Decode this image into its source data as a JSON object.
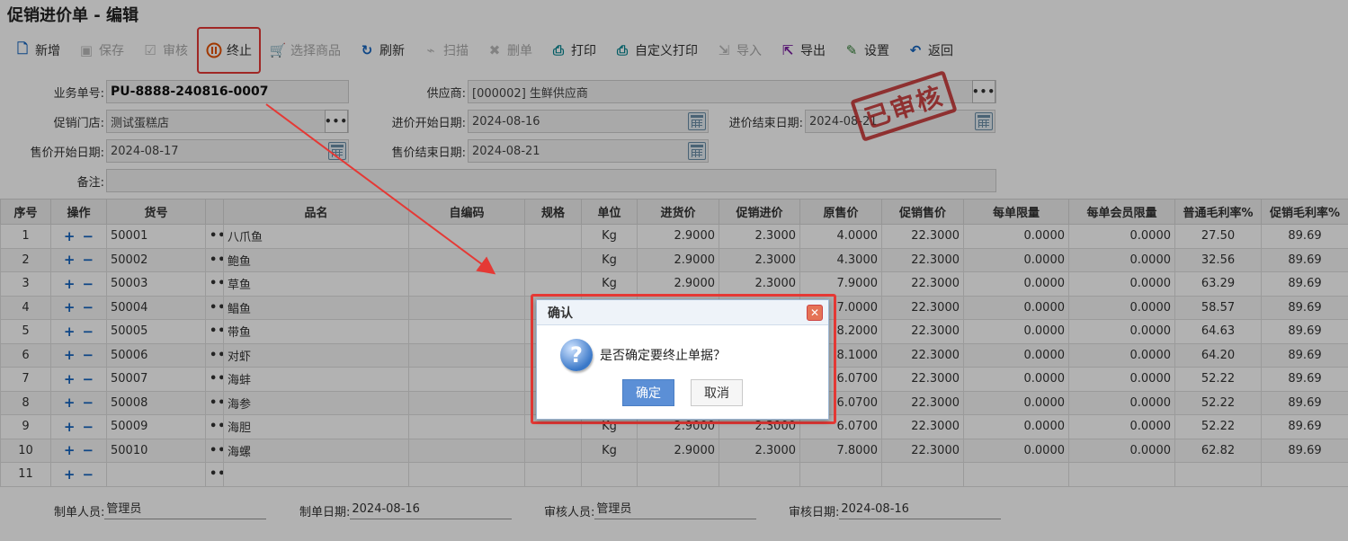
{
  "page": {
    "title": "促销进价单 - 编辑"
  },
  "toolbar": {
    "buttons": [
      {
        "label": "新增",
        "icon": "add-doc-icon",
        "enabled": true,
        "color": "#1565c0"
      },
      {
        "label": "保存",
        "icon": "save-icon",
        "enabled": false,
        "color": "#2e7d32"
      },
      {
        "label": "审核",
        "icon": "approve-icon",
        "enabled": false,
        "color": "#e65100"
      },
      {
        "label": "终止",
        "icon": "pause-icon",
        "enabled": true,
        "color": "#e65100"
      },
      {
        "label": "选择商品",
        "icon": "cart-icon",
        "enabled": false,
        "color": "#1565c0"
      },
      {
        "label": "刷新",
        "icon": "refresh-icon",
        "enabled": true,
        "color": "#1565c0"
      },
      {
        "label": "扫描",
        "icon": "scan-icon",
        "enabled": false,
        "color": "#2e7d32"
      },
      {
        "label": "删单",
        "icon": "delete-doc-icon",
        "enabled": false,
        "color": "#c62828"
      },
      {
        "label": "打印",
        "icon": "print-icon",
        "enabled": true,
        "color": "#00838f"
      },
      {
        "label": "自定义打印",
        "icon": "custom-print-icon",
        "enabled": true,
        "color": "#00838f"
      },
      {
        "label": "导入",
        "icon": "import-icon",
        "enabled": false,
        "color": "#2e7d32"
      },
      {
        "label": "导出",
        "icon": "export-icon",
        "enabled": true,
        "color": "#7b1fa2"
      },
      {
        "label": "设置",
        "icon": "settings-icon",
        "enabled": true,
        "color": "#2e7d32"
      },
      {
        "label": "返回",
        "icon": "back-icon",
        "enabled": true,
        "color": "#1565c0"
      }
    ]
  },
  "form": {
    "order_no_label": "业务单号:",
    "order_no": "PU-8888-240816-0007",
    "supplier_label": "供应商:",
    "supplier": "[000002] 生鲜供应商",
    "store_label": "促销门店:",
    "store": "测试蛋糕店",
    "purchase_start_label": "进价开始日期:",
    "purchase_start": "2024-08-16",
    "purchase_end_label": "进价结束日期:",
    "purchase_end": "2024-08-21",
    "sale_start_label": "售价开始日期:",
    "sale_start": "2024-08-17",
    "sale_end_label": "售价结束日期:",
    "sale_end": "2024-08-21",
    "remark_label": "备注:",
    "remark": ""
  },
  "stamp": {
    "text": "已审核",
    "color": "#c62828"
  },
  "table": {
    "headers": [
      "序号",
      "操作",
      "货号",
      "",
      "品名",
      "自编码",
      "规格",
      "单位",
      "进货价",
      "促销进价",
      "原售价",
      "促销售价",
      "每单限量",
      "每单会员限量",
      "普通毛利率%",
      "促销毛利率%"
    ],
    "rows": [
      [
        "1",
        "50001",
        "八爪鱼",
        "Kg",
        "2.9000",
        "2.3000",
        "4.0000",
        "22.3000",
        "0.0000",
        "0.0000",
        "27.50",
        "89.69"
      ],
      [
        "2",
        "50002",
        "鲍鱼",
        "Kg",
        "2.9000",
        "2.3000",
        "4.3000",
        "22.3000",
        "0.0000",
        "0.0000",
        "32.56",
        "89.69"
      ],
      [
        "3",
        "50003",
        "草鱼",
        "Kg",
        "2.9000",
        "2.3000",
        "7.9000",
        "22.3000",
        "0.0000",
        "0.0000",
        "63.29",
        "89.69"
      ],
      [
        "4",
        "50004",
        "鲳鱼",
        "",
        "",
        "",
        "7.0000",
        "22.3000",
        "0.0000",
        "0.0000",
        "58.57",
        "89.69"
      ],
      [
        "5",
        "50005",
        "带鱼",
        "",
        "",
        "",
        "8.2000",
        "22.3000",
        "0.0000",
        "0.0000",
        "64.63",
        "89.69"
      ],
      [
        "6",
        "50006",
        "对虾",
        "",
        "",
        "",
        "8.1000",
        "22.3000",
        "0.0000",
        "0.0000",
        "64.20",
        "89.69"
      ],
      [
        "7",
        "50007",
        "海蚌",
        "",
        "",
        "",
        "6.0700",
        "22.3000",
        "0.0000",
        "0.0000",
        "52.22",
        "89.69"
      ],
      [
        "8",
        "50008",
        "海参",
        "",
        "",
        "",
        "6.0700",
        "22.3000",
        "0.0000",
        "0.0000",
        "52.22",
        "89.69"
      ],
      [
        "9",
        "50009",
        "海胆",
        "Kg",
        "2.9000",
        "2.3000",
        "6.0700",
        "22.3000",
        "0.0000",
        "0.0000",
        "52.22",
        "89.69"
      ],
      [
        "10",
        "50010",
        "海螺",
        "Kg",
        "2.9000",
        "2.3000",
        "7.8000",
        "22.3000",
        "0.0000",
        "0.0000",
        "62.82",
        "89.69"
      ],
      [
        "11",
        "",
        "",
        "",
        "",
        "",
        "",
        "",
        "",
        "",
        "",
        ""
      ]
    ]
  },
  "footer": {
    "creator_label": "制单人员:",
    "creator": "管理员",
    "create_date_label": "制单日期:",
    "create_date": "2024-08-16",
    "auditor_label": "审核人员:",
    "auditor": "管理员",
    "audit_date_label": "审核日期:",
    "audit_date": "2024-08-16"
  },
  "dialog": {
    "title": "确认",
    "message": "是否确定要终止单据？",
    "ok": "确定",
    "cancel": "取消",
    "close_glyph": "✕"
  }
}
